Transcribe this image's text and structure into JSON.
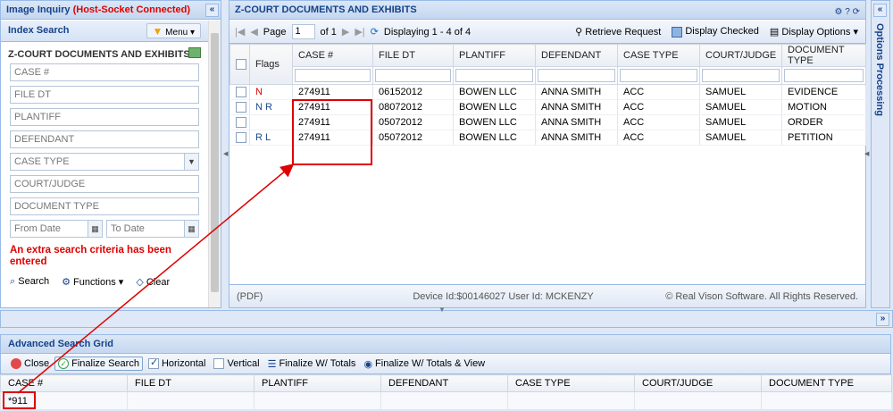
{
  "left": {
    "title_prefix": "Image Inquiry",
    "title_status": "(Host-Socket Connected)",
    "collapse": "«",
    "subheader": "Index Search",
    "menu_label": "Menu",
    "form_title": "Z-COURT DOCUMENTS AND EXHIBITS",
    "fields": [
      "CASE #",
      "FILE DT",
      "PLANTIFF",
      "DEFENDANT",
      "CASE TYPE",
      "COURT/JUDGE",
      "DOCUMENT TYPE"
    ],
    "from_date": "From Date",
    "to_date": "To Date",
    "warning": "An extra search criteria has been entered",
    "search_label": "Search",
    "functions_label": "Functions",
    "clear_label": "Clear"
  },
  "main": {
    "title": "Z-COURT DOCUMENTS AND EXHIBITS",
    "page_label": "Page",
    "page_value": "1",
    "of_label": "of 1",
    "displaying": "Displaying 1 - 4 of 4",
    "retrieve": "Retrieve Request",
    "display_checked": "Display Checked",
    "display_options": "Display Options",
    "columns": [
      "Flags",
      "CASE #",
      "FILE DT",
      "PLANTIFF",
      "DEFENDANT",
      "CASE TYPE",
      "COURT/JUDGE",
      "DOCUMENT TYPE"
    ],
    "rows": [
      {
        "flag1": "N",
        "flag2": "",
        "case": "274911",
        "file_dt": "06152012",
        "plantiff": "BOWEN LLC",
        "defendant": "ANNA SMITH",
        "case_type": "ACC",
        "judge": "SAMUEL",
        "doc_type": "EVIDENCE"
      },
      {
        "flag1": "N",
        "flag2": "R",
        "case": "274911",
        "file_dt": "08072012",
        "plantiff": "BOWEN LLC",
        "defendant": "ANNA SMITH",
        "case_type": "ACC",
        "judge": "SAMUEL",
        "doc_type": "MOTION"
      },
      {
        "flag1": "",
        "flag2": "",
        "case": "274911",
        "file_dt": "05072012",
        "plantiff": "BOWEN LLC",
        "defendant": "ANNA SMITH",
        "case_type": "ACC",
        "judge": "SAMUEL",
        "doc_type": "ORDER"
      },
      {
        "flag1": "",
        "flag2": "R L",
        "case": "274911",
        "file_dt": "05072012",
        "plantiff": "BOWEN LLC",
        "defendant": "ANNA SMITH",
        "case_type": "ACC",
        "judge": "SAMUEL",
        "doc_type": "PETITION"
      }
    ],
    "status_left": "(PDF)",
    "status_mid": "Device Id:$00146027   User Id: MCKENZY",
    "status_right": "© Real Vison Software. All Rights Reserved."
  },
  "options_panel": {
    "label": "Options Processing",
    "collapse": "«"
  },
  "advanced": {
    "title": "Advanced Search Grid",
    "close": "Close",
    "finalize": "Finalize Search",
    "horizontal": "Horizontal",
    "vertical": "Vertical",
    "finalize_totals": "Finalize W/ Totals",
    "finalize_totals_view": "Finalize W/ Totals & View",
    "columns": [
      "CASE #",
      "FILE DT",
      "PLANTIFF",
      "DEFENDANT",
      "CASE TYPE",
      "COURT/JUDGE",
      "DOCUMENT TYPE"
    ],
    "row": [
      "*911",
      "",
      "",
      "",
      "",
      "",
      ""
    ],
    "expand": "»"
  }
}
